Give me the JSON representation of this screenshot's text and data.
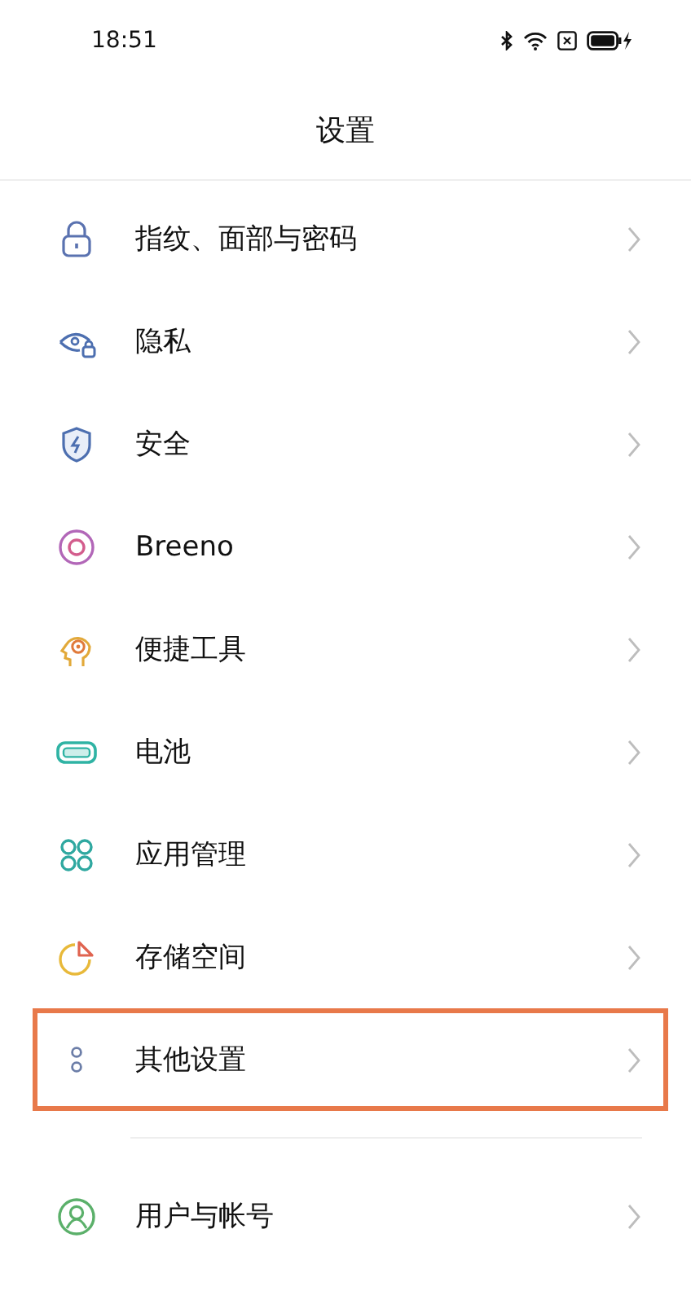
{
  "status_bar": {
    "time": "18:51"
  },
  "header": {
    "title": "设置"
  },
  "groups": [
    [
      {
        "label": "指纹、面部与密码",
        "kind": "lock",
        "highlighted": false
      },
      {
        "label": "隐私",
        "kind": "eye",
        "highlighted": false
      },
      {
        "label": "安全",
        "kind": "shield",
        "highlighted": false
      },
      {
        "label": "Breeno",
        "kind": "ring",
        "highlighted": false
      },
      {
        "label": "便捷工具",
        "kind": "head",
        "highlighted": false
      },
      {
        "label": "电池",
        "kind": "battery",
        "highlighted": false
      },
      {
        "label": "应用管理",
        "kind": "apps",
        "highlighted": false
      },
      {
        "label": "存储空间",
        "kind": "pie",
        "highlighted": false
      },
      {
        "label": "其他设置",
        "kind": "dots",
        "highlighted": true
      }
    ],
    [
      {
        "label": "用户与帐号",
        "kind": "user",
        "highlighted": false
      }
    ]
  ]
}
